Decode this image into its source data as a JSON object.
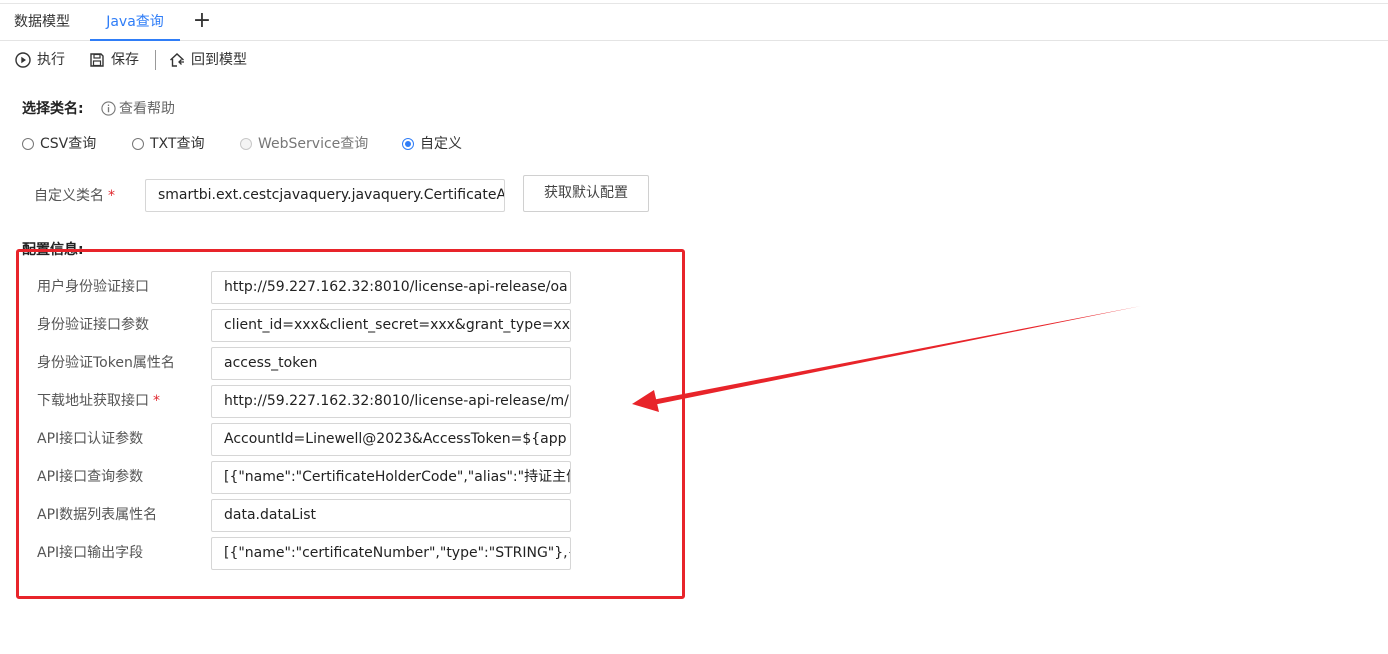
{
  "tabs": [
    {
      "label": "数据模型",
      "active": false
    },
    {
      "label": "Java查询",
      "active": true
    }
  ],
  "tab_add_label": "+",
  "toolbar": {
    "run_label": "执行",
    "save_label": "保存",
    "back_label": "回到模型"
  },
  "class_section": {
    "title": "选择类名:",
    "help_label": "查看帮助",
    "radios": [
      {
        "label": "CSV查询",
        "checked": false,
        "disabled": false
      },
      {
        "label": "TXT查询",
        "checked": false,
        "disabled": false
      },
      {
        "label": "WebService查询",
        "checked": false,
        "disabled": true
      },
      {
        "label": "自定义",
        "checked": true,
        "disabled": false
      }
    ],
    "custom_class_label": "自定义类名",
    "custom_class_value": "smartbi.ext.cestcjavaquery.javaquery.CertificateA",
    "get_default_button": "获取默认配置"
  },
  "config_section": {
    "title": "配置信息:",
    "fields": [
      {
        "label": "用户身份验证接口",
        "required": false,
        "value": "http://59.227.162.32:8010/license-api-release/oa"
      },
      {
        "label": "身份验证接口参数",
        "required": false,
        "value": "client_id=xxx&client_secret=xxx&grant_type=xxx"
      },
      {
        "label": "身份验证Token属性名",
        "required": false,
        "value": "access_token"
      },
      {
        "label": "下载地址获取接口",
        "required": true,
        "value": "http://59.227.162.32:8010/license-api-release/m/"
      },
      {
        "label": "API接口认证参数",
        "required": false,
        "value": "AccountId=Linewell@2023&AccessToken=${app"
      },
      {
        "label": "API接口查询参数",
        "required": false,
        "value": "[{\"name\":\"CertificateHolderCode\",\"alias\":\"持证主体"
      },
      {
        "label": "API数据列表属性名",
        "required": false,
        "value": "data.dataList"
      },
      {
        "label": "API接口输出字段",
        "required": false,
        "value": "[{\"name\":\"certificateNumber\",\"type\":\"STRING\"},{\""
      }
    ]
  },
  "required_mark": "*",
  "colors": {
    "accent": "#2f7df7",
    "annotation_red": "#e8242a",
    "required_red": "#e0282e"
  }
}
